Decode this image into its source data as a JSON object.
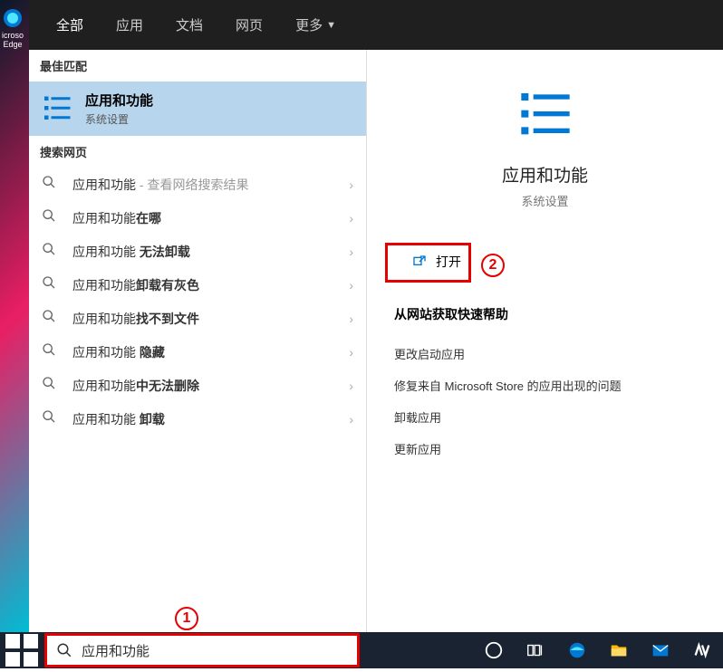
{
  "edge": {
    "label1": "icroso",
    "label2": "Edge"
  },
  "tabs": {
    "all": "全部",
    "apps": "应用",
    "docs": "文档",
    "web": "网页",
    "more": "更多"
  },
  "sections": {
    "best": "最佳匹配",
    "web": "搜索网页"
  },
  "bestMatch": {
    "title": "应用和功能",
    "sub": "系统设置"
  },
  "webResults": [
    {
      "prefix": "应用和功能",
      "suffix": "",
      "hint": " - 查看网络搜索结果"
    },
    {
      "prefix": "应用和功能",
      "suffix": "在哪",
      "hint": ""
    },
    {
      "prefix": "应用和功能 ",
      "suffix": "无法卸载",
      "hint": ""
    },
    {
      "prefix": "应用和功能",
      "suffix": "卸载有灰色",
      "hint": ""
    },
    {
      "prefix": "应用和功能",
      "suffix": "找不到文件",
      "hint": ""
    },
    {
      "prefix": "应用和功能 ",
      "suffix": "隐藏",
      "hint": ""
    },
    {
      "prefix": "应用和功能",
      "suffix": "中无法删除",
      "hint": ""
    },
    {
      "prefix": "应用和功能 ",
      "suffix": "卸载",
      "hint": ""
    }
  ],
  "detail": {
    "title": "应用和功能",
    "sub": "系统设置",
    "open": "打开",
    "helpHeader": "从网站获取快速帮助",
    "helpLinks": [
      "更改启动应用",
      "修复来自 Microsoft Store 的应用出现的问题",
      "卸载应用",
      "更新应用"
    ]
  },
  "search": {
    "value": "应用和功能"
  },
  "annotations": {
    "one": "1",
    "two": "2"
  }
}
